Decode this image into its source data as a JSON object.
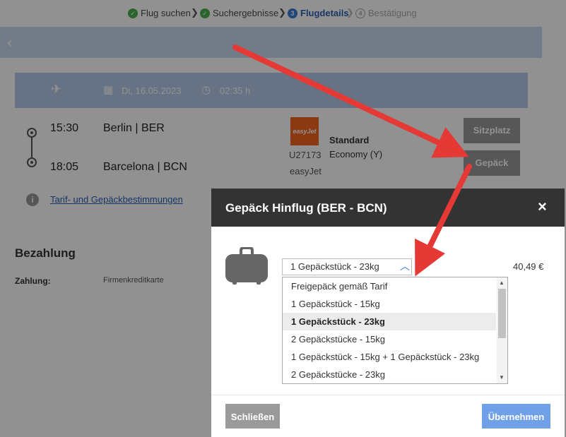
{
  "steps": [
    {
      "label": "Flug suchen",
      "state": "done"
    },
    {
      "label": "Suchergebnisse",
      "state": "done"
    },
    {
      "label": "Flugdetails",
      "state": "current",
      "num": "3"
    },
    {
      "label": "Bestätigung",
      "state": "future",
      "num": "4"
    }
  ],
  "flight": {
    "date": "Di,  16.05.2023",
    "duration": "02:35 h",
    "dep_time": "15:30",
    "dep_city": "Berlin | BER",
    "arr_time": "18:05",
    "arr_city": "Barcelona | BCN",
    "airline_logo": "easyJet",
    "flight_no": "U27173",
    "airline": "easyJet",
    "fare": "Standard",
    "cabin": "Economy (Y)",
    "seat_label": "Sitzplatz",
    "baggage_label": "Gepäck",
    "tarif_link": "Tarif- und Gepäckbestimmungen"
  },
  "payment": {
    "heading": "Bezahlung",
    "label": "Zahlung:",
    "value": "Firmenkreditkarte"
  },
  "modal": {
    "title": "Gepäck Hinflug (BER - BCN)",
    "close_icon": "×",
    "selected": "1 Gepäckstück - 23kg",
    "price": "40,49 €",
    "options": [
      "Freigepäck gemäß Tarif",
      "1 Gepäckstück - 15kg",
      "1 Gepäckstück - 23kg",
      "2 Gepäckstücke - 15kg",
      "1 Gepäckstück - 15kg + 1 Gepäckstück - 23kg",
      "2 Gepäckstücke - 23kg"
    ],
    "selected_index": 2,
    "close_button": "Schließen",
    "apply_button": "Übernehmen"
  },
  "colors": {
    "accent_blue": "#6fa0e8",
    "arrow_red": "#e53935",
    "header_dark": "#333333"
  }
}
